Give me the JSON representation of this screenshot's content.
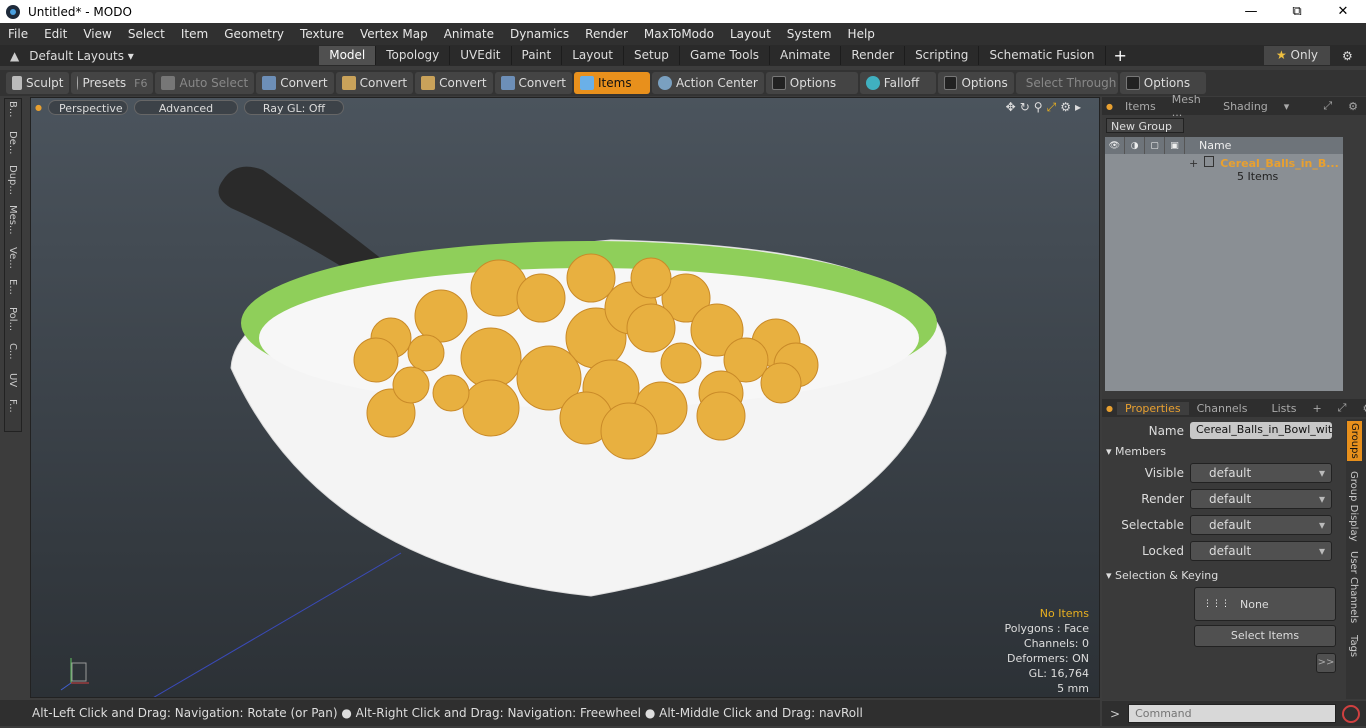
{
  "window": {
    "title": "Untitled* - MODO"
  },
  "menu": [
    "File",
    "Edit",
    "View",
    "Select",
    "Item",
    "Geometry",
    "Texture",
    "Vertex Map",
    "Animate",
    "Dynamics",
    "Render",
    "MaxToModo",
    "Layout",
    "System",
    "Help"
  ],
  "layout": {
    "preset": "Default Layouts",
    "tabs": [
      "Model",
      "Topology",
      "UVEdit",
      "Paint",
      "Layout",
      "Setup",
      "Game Tools",
      "Animate",
      "Render",
      "Scripting",
      "Schematic Fusion"
    ],
    "active": "Model",
    "only_label": "Only"
  },
  "toolbar": {
    "sculpt": "Sculpt",
    "presets": "Presets",
    "presets_key": "F6",
    "auto_select": "Auto Select",
    "convert": "Convert",
    "items": "Items",
    "action_center": "Action Center",
    "options": "Options",
    "falloff": "Falloff",
    "select_through": "Select Through"
  },
  "left_tabs": [
    "B...",
    "De...",
    "Dup...",
    "Mes...",
    "Ve...",
    "E...",
    "Pol...",
    "C...",
    "UV",
    "F..."
  ],
  "viewport": {
    "view": "Perspective",
    "shading": "Advanced",
    "raygl": "Ray GL: Off"
  },
  "stats": {
    "no_items": "No Items",
    "polygons": "Polygons : Face",
    "channels": "Channels: 0",
    "deformers": "Deformers: ON",
    "gl": "GL: 16,764",
    "grid": "5 mm"
  },
  "status": "Alt-Left Click and Drag: Navigation: Rotate (or Pan) ● Alt-Right Click and Drag: Navigation: Freewheel ● Alt-Middle Click and Drag: navRoll",
  "panel_tabs": [
    "Items",
    "Mesh ...",
    "Shading"
  ],
  "item_list": {
    "new_group": "New Group",
    "col_name": "Name",
    "group_name": "Cereal_Balls_in_B...",
    "group_count": "5 Items"
  },
  "prop_tabs": [
    "Properties",
    "Channels",
    "Lists"
  ],
  "props": {
    "name_label": "Name",
    "name_value": "Cereal_Balls_in_Bowl_with_",
    "members": "Members",
    "rows": [
      {
        "label": "Visible",
        "value": "default"
      },
      {
        "label": "Render",
        "value": "default"
      },
      {
        "label": "Selectable",
        "value": "default"
      },
      {
        "label": "Locked",
        "value": "default"
      }
    ],
    "sel_keying": "Selection & Keying",
    "none": "None",
    "select_items": "Select Items",
    "more": ">>"
  },
  "side_tabs": [
    "Groups",
    "Group Display",
    "User Channels",
    "Tags"
  ],
  "command_placeholder": "Command"
}
